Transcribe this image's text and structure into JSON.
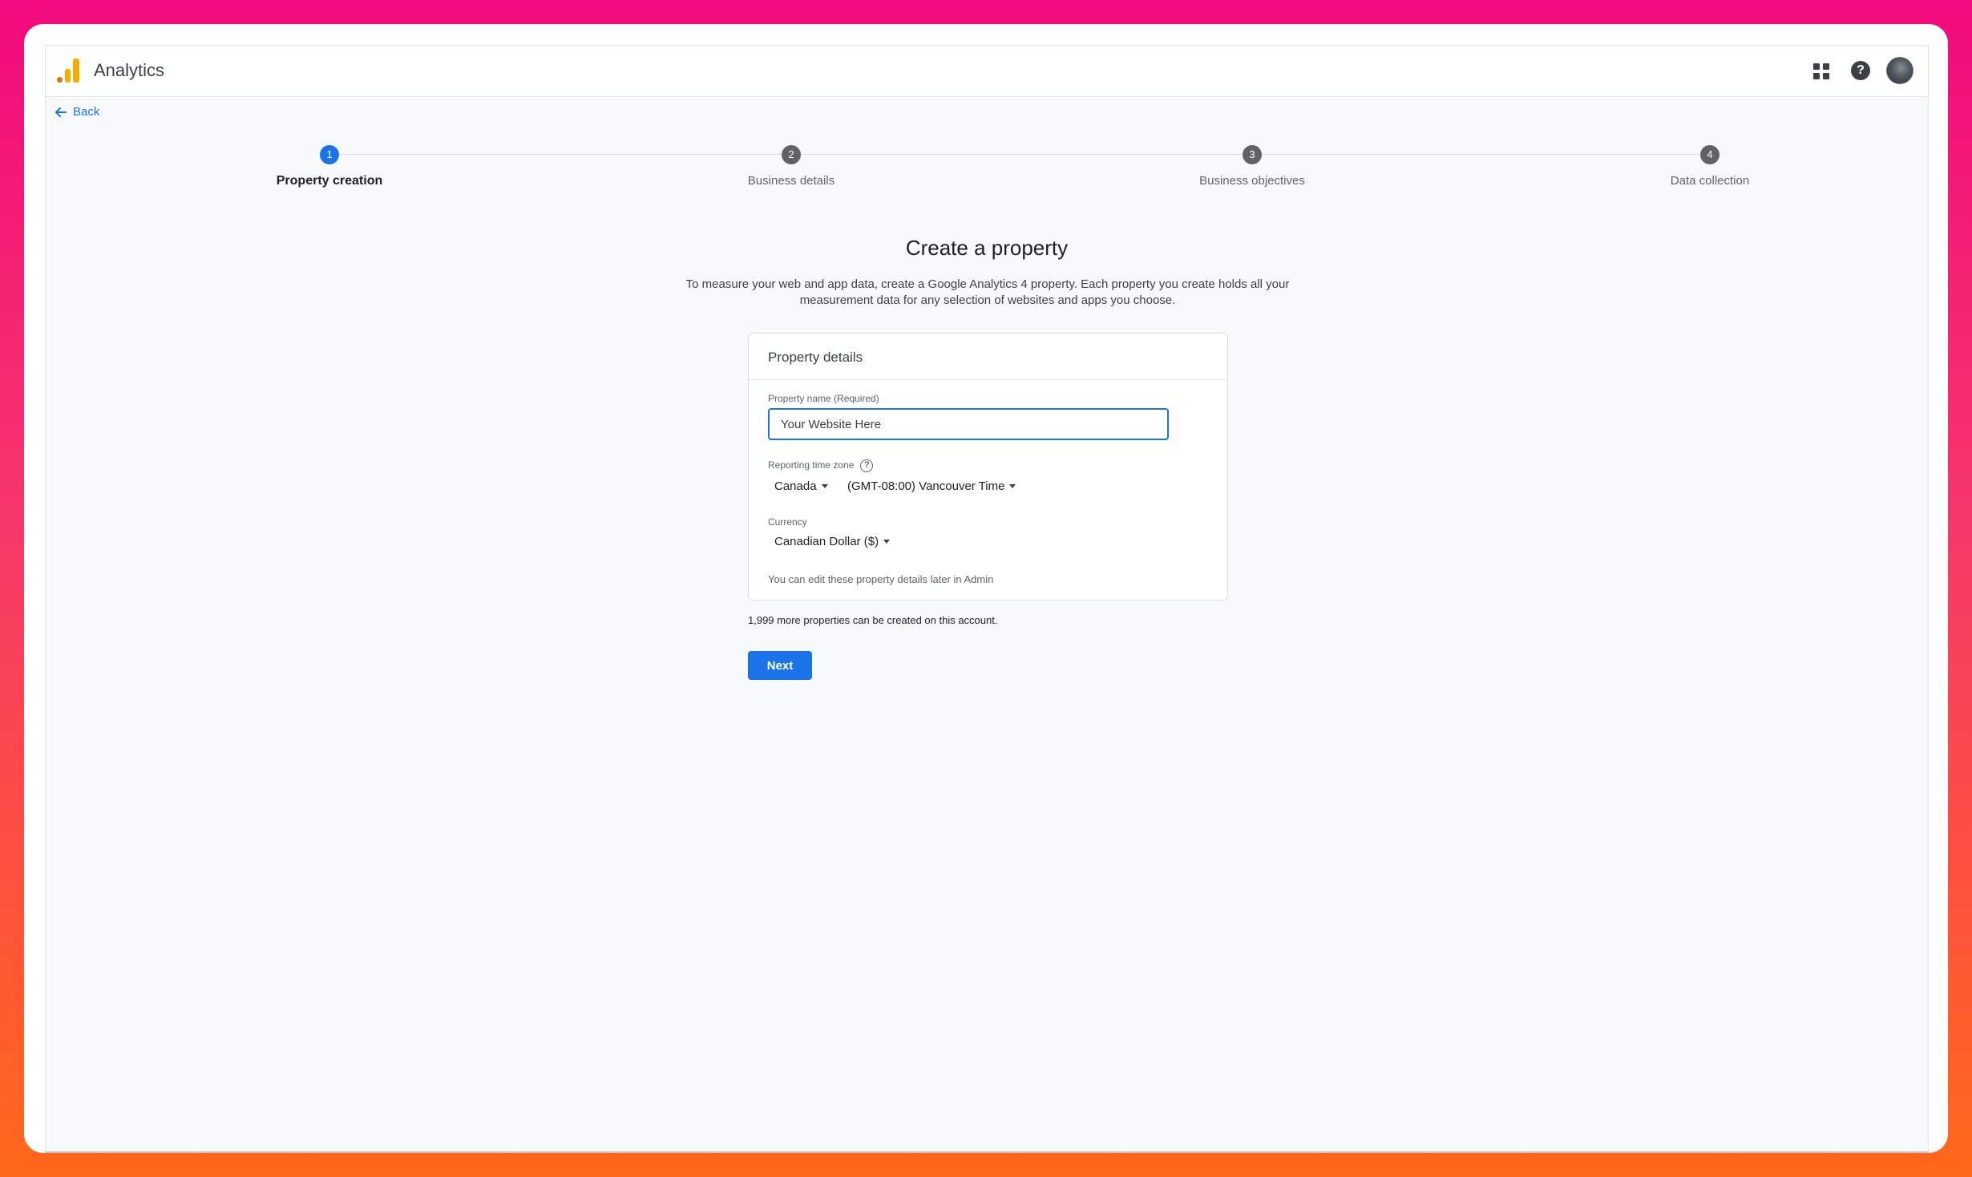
{
  "header": {
    "app_title": "Analytics",
    "icons": [
      "analytics-logo-icon",
      "apps-grid-icon",
      "help-icon",
      "avatar"
    ]
  },
  "back": {
    "label": "Back"
  },
  "stepper": {
    "steps": [
      {
        "number": "1",
        "label": "Property creation",
        "active": true
      },
      {
        "number": "2",
        "label": "Business details",
        "active": false
      },
      {
        "number": "3",
        "label": "Business objectives",
        "active": false
      },
      {
        "number": "4",
        "label": "Data collection",
        "active": false
      }
    ]
  },
  "main": {
    "title": "Create a property",
    "description": "To measure your web and app data, create a Google Analytics 4 property. Each property you create holds all your measurement data for any selection of websites and apps you choose."
  },
  "card": {
    "heading": "Property details",
    "property_name_label": "Property name (Required)",
    "property_name_value": "Your Website Here",
    "time_zone_label": "Reporting time zone",
    "country_value": "Canada",
    "time_zone_value": "(GMT-08:00) Vancouver Time",
    "currency_label": "Currency",
    "currency_value": "Canadian Dollar ($)",
    "note": "You can edit these property details later in Admin"
  },
  "remaining_text": "1,999 more properties can be created on this account.",
  "next_button": {
    "label": "Next"
  },
  "colors": {
    "accent": "#1a73e8",
    "inactive_step": "#5f6368",
    "logo_orange": "#f9ab00",
    "logo_dark_orange": "#e37400"
  }
}
